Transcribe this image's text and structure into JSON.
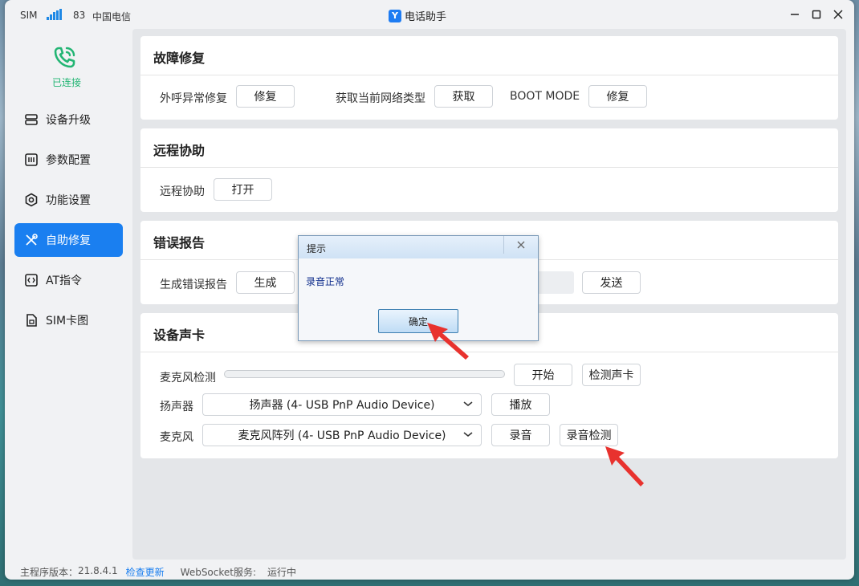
{
  "titlebar": {
    "sim_label": "SIM",
    "signal_value": "83",
    "carrier": "中国电信",
    "app_title": "电话助手",
    "logo_glyph": "Y"
  },
  "sidebar": {
    "status": "已连接",
    "items": [
      {
        "label": "设备升级",
        "icon": "device-upgrade-icon"
      },
      {
        "label": "参数配置",
        "icon": "chip-icon"
      },
      {
        "label": "功能设置",
        "icon": "gear-icon"
      },
      {
        "label": "自助修复",
        "icon": "tools-icon",
        "active": true
      },
      {
        "label": "AT指令",
        "icon": "code-icon"
      },
      {
        "label": "SIM卡图",
        "icon": "sim-card-icon"
      }
    ]
  },
  "main": {
    "repair": {
      "title": "故障修复",
      "outbound_label": "外呼异常修复",
      "outbound_btn": "修复",
      "network_label": "获取当前网络类型",
      "network_btn": "获取",
      "boot_label": "BOOT MODE",
      "boot_btn": "修复"
    },
    "remote": {
      "title": "远程协助",
      "label": "远程协助",
      "btn": "打开"
    },
    "error": {
      "title": "错误报告",
      "label": "生成错误报告",
      "generate_btn": "生成",
      "send_btn": "发送"
    },
    "sound": {
      "title": "设备声卡",
      "mic_test_label": "麦克风检测",
      "mic_level": 0,
      "start_btn": "开始",
      "check_card_btn": "检测声卡",
      "speaker_label": "扬声器",
      "speaker_value": "扬声器 (4- USB PnP Audio Device)",
      "play_btn": "播放",
      "mic_label": "麦克风",
      "mic_value": "麦克风阵列 (4- USB PnP Audio Device)",
      "record_btn": "录音",
      "record_check_btn": "录音检测"
    }
  },
  "statusbar": {
    "version_label": "主程序版本：",
    "version": "21.8.4.1",
    "update_link": "检查更新",
    "ws_label": "WebSocket服务:",
    "ws_status": "运行中"
  },
  "dialog": {
    "title": "提示",
    "message": "录音正常",
    "ok": "确定"
  },
  "colors": {
    "accent": "#1a7ff0",
    "connected": "#22b573",
    "arrow": "#e8322e"
  }
}
